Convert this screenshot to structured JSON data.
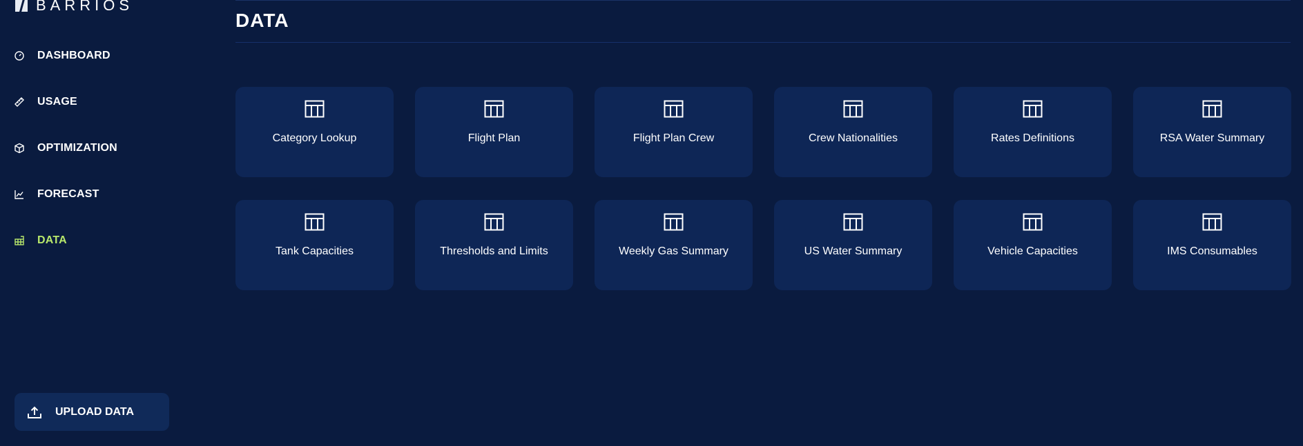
{
  "app": {
    "logo_text": "BARRIOS"
  },
  "sidebar": {
    "items": [
      {
        "label": "DASHBOARD",
        "icon": "gauge-icon",
        "active": false
      },
      {
        "label": "USAGE",
        "icon": "ruler-icon",
        "active": false
      },
      {
        "label": "OPTIMIZATION",
        "icon": "cube-icon",
        "active": false
      },
      {
        "label": "FORECAST",
        "icon": "line-chart-icon",
        "active": false
      },
      {
        "label": "DATA",
        "icon": "data-table-icon",
        "active": true
      }
    ],
    "upload": {
      "label": "UPLOAD DATA",
      "icon": "upload-icon"
    }
  },
  "main": {
    "title": "DATA",
    "cards": [
      {
        "label": "Category Lookup",
        "icon": "table-icon"
      },
      {
        "label": "Flight Plan",
        "icon": "table-icon"
      },
      {
        "label": "Flight Plan Crew",
        "icon": "table-icon"
      },
      {
        "label": "Crew Nationalities",
        "icon": "table-icon"
      },
      {
        "label": "Rates Definitions",
        "icon": "table-icon"
      },
      {
        "label": "RSA Water Summary",
        "icon": "table-icon"
      },
      {
        "label": "Tank Capacities",
        "icon": "table-icon"
      },
      {
        "label": "Thresholds and Limits",
        "icon": "table-icon"
      },
      {
        "label": "Weekly Gas Summary",
        "icon": "table-icon"
      },
      {
        "label": "US Water Summary",
        "icon": "table-icon"
      },
      {
        "label": "Vehicle Capacities",
        "icon": "table-icon"
      },
      {
        "label": "IMS Consumables",
        "icon": "table-icon"
      }
    ]
  },
  "colors": {
    "background": "#0a1b3f",
    "card": "#0e2656",
    "upload_button": "#102a59",
    "active_accent": "#b8e86b",
    "text": "#ffffff"
  }
}
